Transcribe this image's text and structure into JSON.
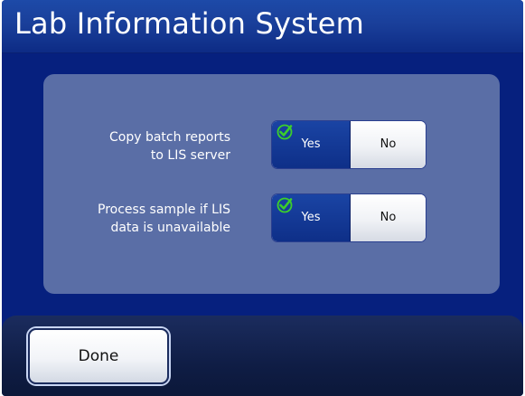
{
  "header": {
    "title": "Lab Information System"
  },
  "settings": [
    {
      "label": "Copy batch reports\nto LIS server",
      "yes_label": "Yes",
      "no_label": "No",
      "selected": "Yes"
    },
    {
      "label": "Process sample if LIS\ndata is unavailable",
      "yes_label": "Yes",
      "no_label": "No",
      "selected": "Yes"
    }
  ],
  "footer": {
    "done_label": "Done"
  },
  "colors": {
    "background": "#06207e",
    "panel": "#5a6ea6",
    "selected": "#1a44a4",
    "check": "#3ccf2b"
  },
  "icons": {
    "selected_indicator": "checkmark-icon"
  }
}
